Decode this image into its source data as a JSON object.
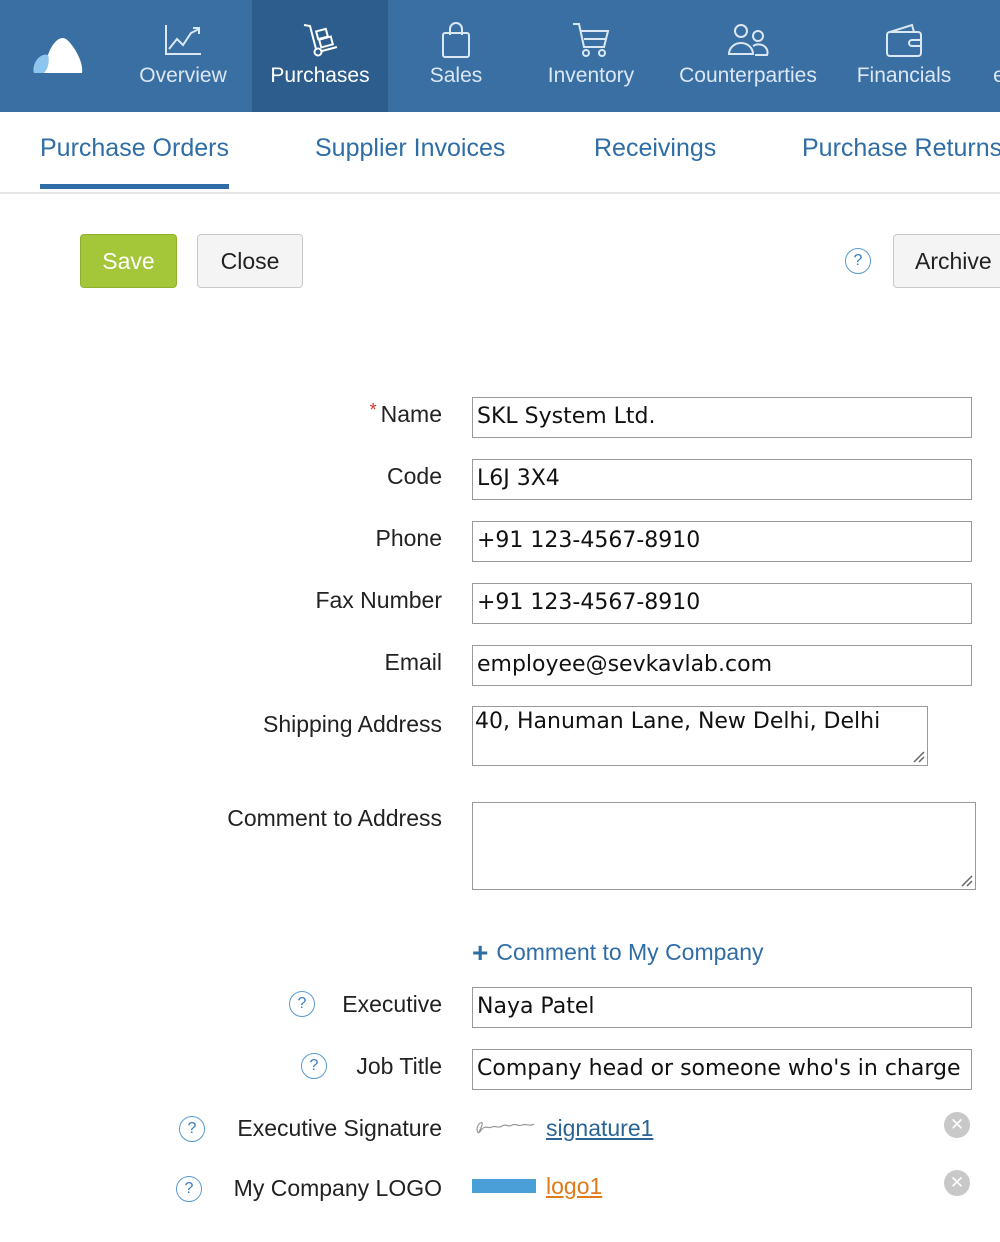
{
  "nav": {
    "items": [
      {
        "label": "Overview",
        "icon": "chart-line-icon"
      },
      {
        "label": "Purchases",
        "icon": "hand-truck-icon",
        "active": true
      },
      {
        "label": "Sales",
        "icon": "shopping-bag-icon"
      },
      {
        "label": "Inventory",
        "icon": "cart-icon"
      },
      {
        "label": "Counterparties",
        "icon": "users-icon"
      },
      {
        "label": "Financials",
        "icon": "wallet-icon"
      },
      {
        "label": "e"
      }
    ]
  },
  "subtabs": [
    {
      "label": "Purchase Orders",
      "active": true
    },
    {
      "label": "Supplier Invoices"
    },
    {
      "label": "Receivings"
    },
    {
      "label": "Purchase Returns"
    }
  ],
  "toolbar": {
    "save_label": "Save",
    "close_label": "Close",
    "archive_label": "Archive",
    "help_symbol": "?"
  },
  "form": {
    "required_mark": "*",
    "name": {
      "label": "Name",
      "value": "SKL System Ltd."
    },
    "code": {
      "label": "Code",
      "value": "L6J 3X4"
    },
    "phone": {
      "label": "Phone",
      "value": "+91 123-4567-8910"
    },
    "fax": {
      "label": "Fax Number",
      "value": "+91 123-4567-8910"
    },
    "email": {
      "label": "Email",
      "value": "employee@sevkavlab.com"
    },
    "shipping": {
      "label": "Shipping Address",
      "value": "40, Hanuman Lane, New Delhi, Delhi"
    },
    "comment_address": {
      "label": "Comment to Address",
      "value": ""
    },
    "add_comment_label": "Comment to My Company",
    "executive": {
      "label": "Executive",
      "value": "Naya Patel"
    },
    "job_title": {
      "label": "Job Title",
      "value": "Company head or someone who's in charge"
    },
    "signature": {
      "label": "Executive Signature",
      "file": "signature1"
    },
    "logo": {
      "label": "My Company LOGO",
      "file": "logo1"
    }
  },
  "colors": {
    "nav_bg": "#3a6fa3",
    "nav_active": "#2d5d8d",
    "accent": "#2f6da6",
    "save_green": "#a4c639",
    "logo_link": "#e07b1a",
    "signature_link": "#2a6496"
  }
}
